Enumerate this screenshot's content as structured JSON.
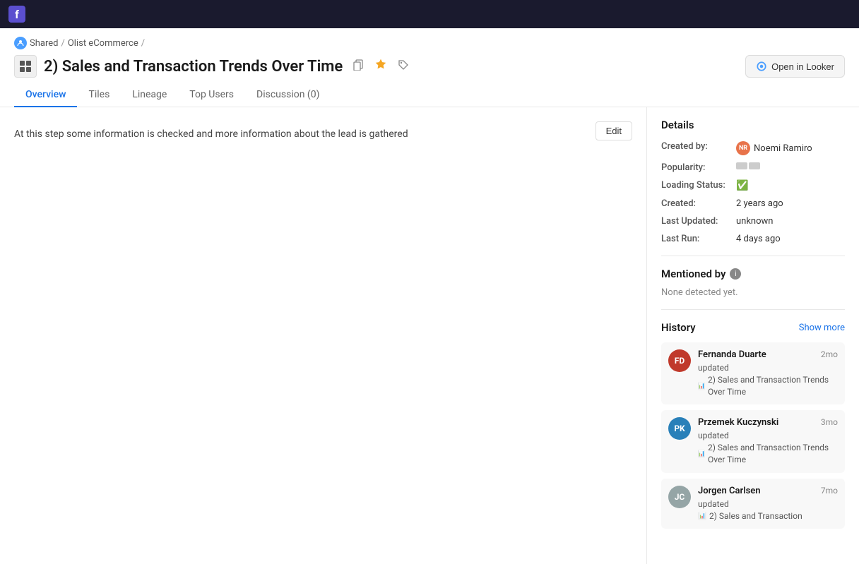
{
  "topbar": {
    "logo": "f"
  },
  "breadcrumb": {
    "icon_label": "S",
    "shared": "Shared",
    "separator1": "/",
    "section": "Olist eCommerce",
    "separator2": "/"
  },
  "page": {
    "title": "2) Sales and Transaction Trends Over Time",
    "icon": "📊",
    "open_looker_label": "Open in Looker"
  },
  "title_action_icons": {
    "copy": "⧉",
    "star": "★",
    "tag": "🏷"
  },
  "tabs": [
    {
      "id": "overview",
      "label": "Overview",
      "active": true
    },
    {
      "id": "tiles",
      "label": "Tiles",
      "active": false
    },
    {
      "id": "lineage",
      "label": "Lineage",
      "active": false
    },
    {
      "id": "top-users",
      "label": "Top Users",
      "active": false
    },
    {
      "id": "discussion",
      "label": "Discussion (0)",
      "active": false
    }
  ],
  "content": {
    "edit_label": "Edit",
    "description": "At this step some information is checked and more information about the lead is gathered"
  },
  "sidebar": {
    "details_title": "Details",
    "created_by_label": "Created by:",
    "created_by_value": "Noemi Ramiro",
    "creator_avatar_color": "#e8734a",
    "creator_initials": "NR",
    "popularity_label": "Popularity:",
    "popularity_bars": [
      {
        "color": "#ccc",
        "filled": false
      },
      {
        "color": "#ccc",
        "filled": false
      }
    ],
    "loading_status_label": "Loading Status:",
    "loading_status_emoji": "✅",
    "created_label": "Created:",
    "created_value": "2 years ago",
    "last_updated_label": "Last Updated:",
    "last_updated_value": "unknown",
    "last_run_label": "Last Run:",
    "last_run_value": "4 days ago",
    "mentioned_by_title": "Mentioned by",
    "none_detected": "None detected yet.",
    "history_title": "History",
    "show_more": "Show more",
    "history_items": [
      {
        "id": "fd",
        "initials": "FD",
        "avatar_color": "#c0392b",
        "name": "Fernanda Duarte",
        "action": "updated",
        "time": "2mo",
        "link_icon": "📊",
        "link_text": "2) Sales and Transaction Trends Over Time"
      },
      {
        "id": "pk",
        "initials": "PK",
        "avatar_color": "#2980b9",
        "name": "Przemek Kuczynski",
        "action": "updated",
        "time": "3mo",
        "link_icon": "📊",
        "link_text": "2) Sales and Transaction Trends Over Time"
      },
      {
        "id": "jc",
        "initials": "JC",
        "avatar_color": "#95a5a6",
        "name": "Jorgen Carlsen",
        "action": "updated",
        "time": "7mo",
        "link_icon": "📊",
        "link_text": "2) Sales and Transaction"
      }
    ]
  }
}
